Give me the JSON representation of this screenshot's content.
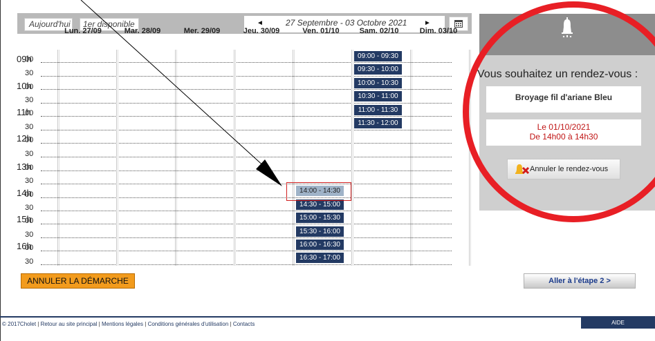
{
  "toolbar": {
    "today_label": "Aujourd'hui",
    "first_available_label": "1er disponible",
    "week_label": "27 Septembre - 03 Octobre 2021",
    "prev_icon": "◄",
    "next_icon": "►",
    "calendar_icon": "calendar-icon"
  },
  "days": [
    "Lun. 27/09",
    "Mar. 28/09",
    "Mer. 29/09",
    "Jeu. 30/09",
    "Ven. 01/10",
    "Sam. 02/10",
    "Dim. 03/10"
  ],
  "hours": [
    "09h",
    "10h",
    "11h",
    "12h",
    "13h",
    "14h",
    "15h",
    "16h"
  ],
  "minutes": [
    "00",
    "30"
  ],
  "slots_saturday": [
    "09:00 - 09:30",
    "09:30 - 10:00",
    "10:00 - 10:30",
    "10:30 - 11:00",
    "11:00 - 11:30",
    "11:30 - 12:00"
  ],
  "slots_friday": [
    "14:00 - 14:30",
    "14:30 - 15:00",
    "15:00 - 15:30",
    "15:30 - 16:00",
    "16:00 - 16:30",
    "16:30 - 17:00"
  ],
  "selected_slot": "14:00 - 14:30",
  "buttons": {
    "cancel_process": "ANNULER LA DÉMARCHE",
    "next_step": "Aller à l'étape 2 >"
  },
  "side": {
    "title": "Vous souhaitez un rendez-vous :",
    "service": "Broyage fil d'ariane Bleu",
    "date_line": "Le 01/10/2021",
    "time_line": "De 14h00 à 14h30",
    "cancel_label": "Annuler le rendez-vous"
  },
  "footer": {
    "copyright": "© 2017Cholet",
    "links": [
      "Retour au site principal",
      "Mentions légales",
      "Conditions générales d'utilisation",
      "Contacts"
    ],
    "help": "AIDE"
  },
  "colors": {
    "slot": "#233a63",
    "selected_slot": "#9fb3c8",
    "cancel_button": "#f29b1d",
    "highlight_ring": "#e81f25"
  }
}
